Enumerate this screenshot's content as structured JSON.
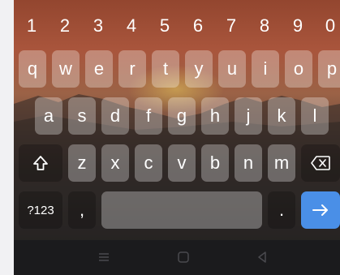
{
  "keyboard": {
    "number_row": [
      "1",
      "2",
      "3",
      "4",
      "5",
      "6",
      "7",
      "8",
      "9",
      "0"
    ],
    "row1": [
      "q",
      "w",
      "e",
      "r",
      "t",
      "y",
      "u",
      "i",
      "o",
      "p"
    ],
    "row2": [
      "a",
      "s",
      "d",
      "f",
      "g",
      "h",
      "j",
      "k",
      "l"
    ],
    "row3": [
      "z",
      "x",
      "c",
      "v",
      "b",
      "n",
      "m"
    ],
    "symbols_label": "?123",
    "comma_label": ",",
    "period_label": ".",
    "enter_icon": "arrow-right-icon",
    "accent_color": "#4a8fe7"
  },
  "navbar": {
    "icons": [
      "recents-icon",
      "home-icon",
      "back-icon"
    ]
  }
}
